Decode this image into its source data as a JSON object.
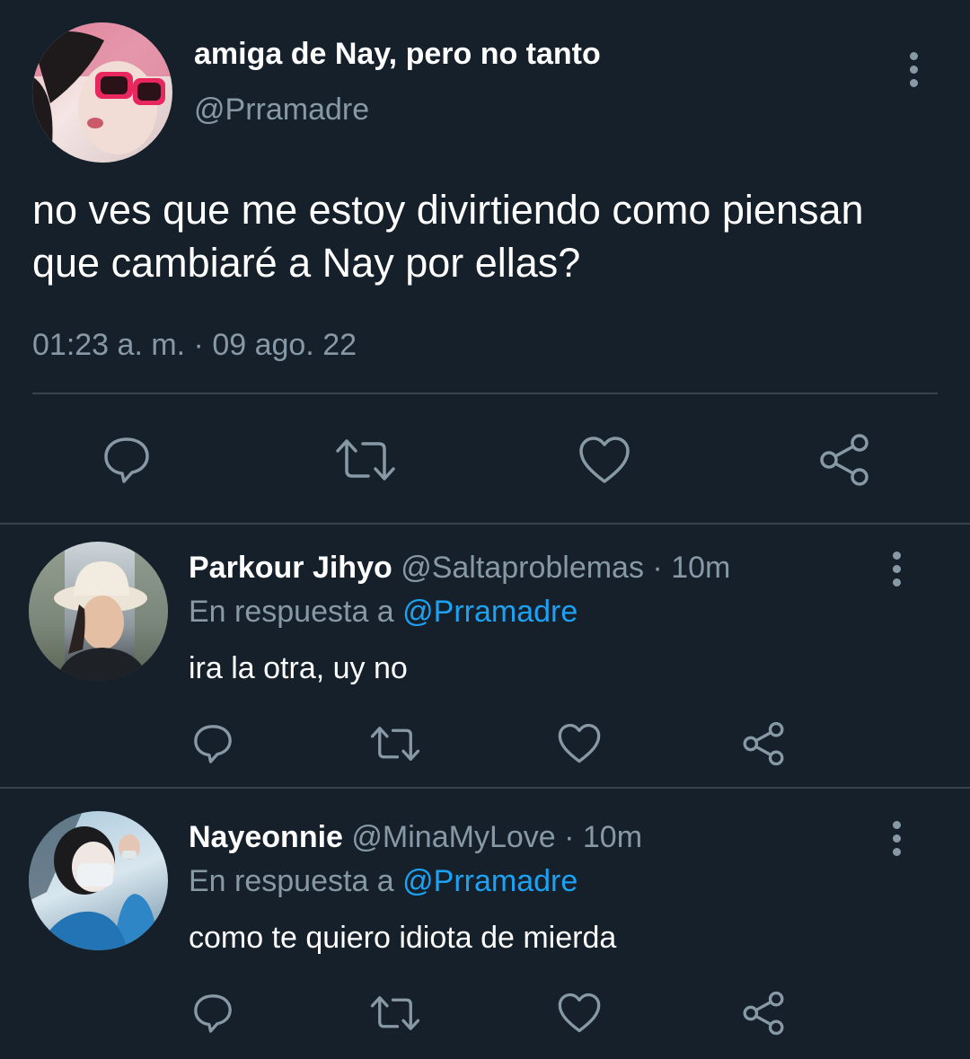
{
  "main_tweet": {
    "display_name": "amiga de Nay, pero no tanto",
    "handle": "@Prramadre",
    "text": "no ves que me estoy divirtiendo como piensan que cambiaré a Nay por ellas?",
    "timestamp": "01:23 a. m. · 09 ago. 22",
    "actions": [
      "reply-icon",
      "retweet-icon",
      "like-icon",
      "share-icon"
    ]
  },
  "replies": [
    {
      "display_name": "Parkour Jihyo",
      "handle": "@Saltaproblemas",
      "time": "· 10m",
      "reply_prefix": "En respuesta a",
      "reply_to": "@Prramadre",
      "text": "ira la otra, uy no"
    },
    {
      "display_name": "Nayeonnie",
      "handle": "@MinaMyLove",
      "time": "· 10m",
      "reply_prefix": "En respuesta a",
      "reply_to": "@Prramadre",
      "text": "como te quiero idiota de mierda"
    }
  ],
  "colors": {
    "background": "#15202b",
    "muted": "#8899a6",
    "link": "#1da1f2",
    "divider": "#38444d"
  }
}
